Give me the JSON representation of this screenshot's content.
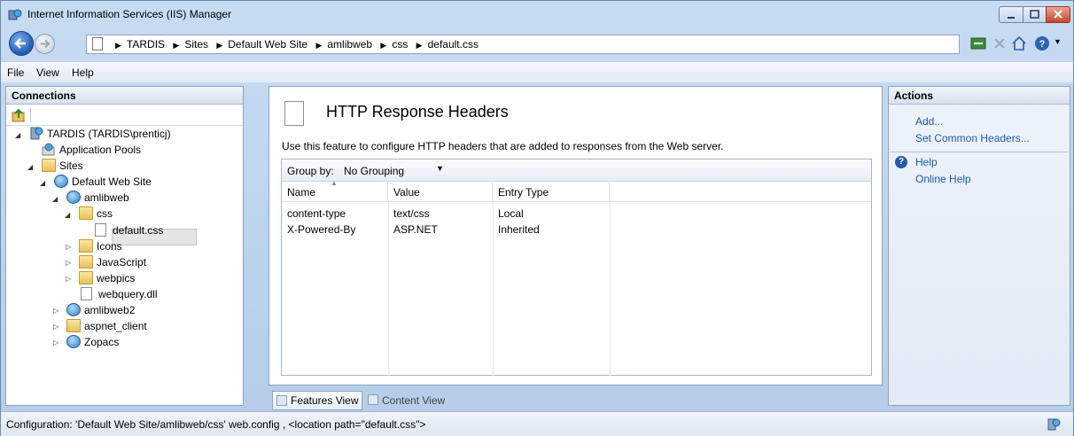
{
  "window": {
    "title": "Internet Information Services (IIS) Manager"
  },
  "breadcrumbs": [
    "TARDIS",
    "Sites",
    "Default Web Site",
    "amlibweb",
    "css",
    "default.css"
  ],
  "menu": [
    "File",
    "View",
    "Help"
  ],
  "connections": {
    "title": "Connections",
    "tree": [
      {
        "label": "TARDIS (TARDIS\\prenticj)",
        "icon": "server-icon"
      },
      {
        "label": "Application Pools",
        "icon": "app-pools-icon"
      },
      {
        "label": "Sites",
        "icon": "sites-folder-icon"
      },
      {
        "label": "Default Web Site",
        "icon": "globe-icon"
      },
      {
        "label": "amlibweb",
        "icon": "web-app-icon"
      },
      {
        "label": "css",
        "icon": "folder-icon"
      },
      {
        "label": "default.css",
        "icon": "file-icon"
      },
      {
        "label": "Icons",
        "icon": "folder-icon"
      },
      {
        "label": "JavaScript",
        "icon": "folder-icon"
      },
      {
        "label": "webpics",
        "icon": "folder-icon"
      },
      {
        "label": "webquery.dll",
        "icon": "file-icon"
      },
      {
        "label": "amlibweb2",
        "icon": "web-app-icon"
      },
      {
        "label": "aspnet_client",
        "icon": "folder-icon"
      },
      {
        "label": "Zopacs",
        "icon": "web-app-icon"
      }
    ]
  },
  "feature": {
    "title": "HTTP Response Headers",
    "description": "Use this feature to configure HTTP headers that are added to responses from the Web server.",
    "group_by_label": "Group by:",
    "group_by_value": "No Grouping",
    "columns": [
      "Name",
      "Value",
      "Entry Type"
    ],
    "rows": [
      {
        "name": "content-type",
        "value": "text/css",
        "entry_type": "Local"
      },
      {
        "name": "X-Powered-By",
        "value": "ASP.NET",
        "entry_type": "Inherited"
      }
    ]
  },
  "view_tabs": {
    "features": "Features View",
    "content": "Content View"
  },
  "actions": {
    "title": "Actions",
    "items": [
      "Add...",
      "Set Common Headers..."
    ],
    "help": [
      "Help",
      "Online Help"
    ]
  },
  "status": "Configuration: 'Default Web Site/amlibweb/css' web.config , <location path=\"default.css\">",
  "colors": {
    "link": "#1c59b0",
    "close_button": "#c7462f"
  }
}
